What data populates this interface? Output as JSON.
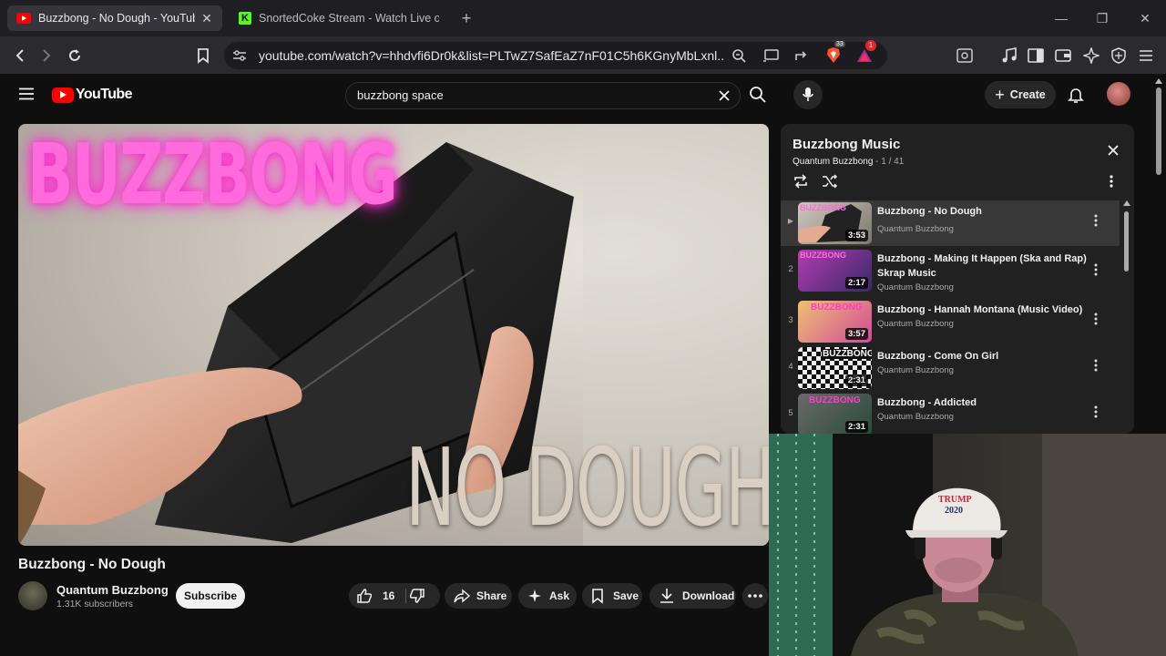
{
  "browser": {
    "tabs": [
      {
        "title": "Buzzbong - No Dough - YouTube",
        "active": true
      },
      {
        "title": "SnortedCoke Stream - Watch Live on",
        "active": false
      }
    ],
    "url": "youtube.com/watch?v=hhdvfi6Dr0k&list=PLTwZ7SafEaZ7nF01C5h6KGnyMbLxnl...",
    "shield_badge": "33",
    "alert_badge": "1"
  },
  "youtube": {
    "logo_text": "YouTube",
    "search": {
      "value": "buzzbong space"
    },
    "create_label": "Create"
  },
  "video": {
    "thumb_top_text": "BUZZBONG",
    "thumb_bottom_text": "NO DOUGH",
    "title": "Buzzbong - No Dough",
    "channel": "Quantum Buzzbong",
    "subscribers": "1.31K subscribers",
    "subscribe_label": "Subscribe",
    "likes": "16",
    "share_label": "Share",
    "ask_label": "Ask",
    "save_label": "Save",
    "download_label": "Download"
  },
  "playlist": {
    "title": "Buzzbong Music",
    "owner": "Quantum Buzzbong",
    "position": "1 / 41",
    "items": [
      {
        "index": "▶",
        "title": "Buzzbong - No Dough",
        "channel": "Quantum Buzzbong",
        "duration": "3:53"
      },
      {
        "index": "2",
        "title": "Buzzbong - Making It Happen (Ska and Rap) Skrap Music",
        "channel": "Quantum Buzzbong",
        "duration": "2:17"
      },
      {
        "index": "3",
        "title": "Buzzbong - Hannah Montana (Music Video)",
        "channel": "Quantum Buzzbong",
        "duration": "3:57"
      },
      {
        "index": "4",
        "title": "Buzzbong - Come On Girl",
        "channel": "Quantum Buzzbong",
        "duration": "2:31"
      },
      {
        "index": "5",
        "title": "Buzzbong - Addicted",
        "channel": "Quantum Buzzbong",
        "duration": "2:31"
      }
    ]
  },
  "webcam": {
    "cap_text_1": "TRUMP",
    "cap_text_2": "2020"
  },
  "colors": {
    "youtube_red": "#ff0000",
    "neon_pink": "#ff4fd8",
    "subscribe_bg": "#f1f1f1"
  }
}
